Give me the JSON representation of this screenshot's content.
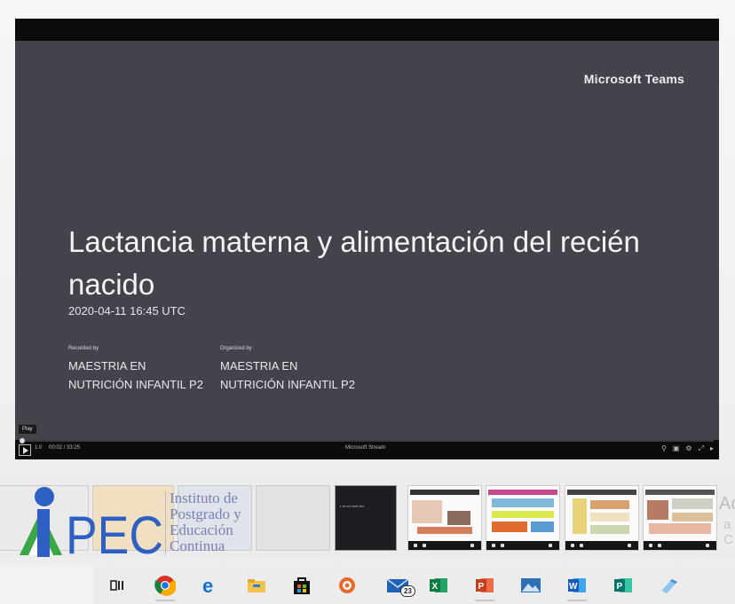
{
  "video": {
    "brand": "Microsoft Teams",
    "title": "Lactancia materna y alimentación del recién nacido",
    "datetime": "2020-04-11 16:45 UTC",
    "recorded_by_label": "Recorded by",
    "recorded_by_name": "MAESTRIA EN NUTRICIÓN INFANTIL P2",
    "organized_by_label": "Organized by",
    "organized_by_name": "MAESTRIA EN NUTRICIÓN INFANTIL P2",
    "play_tooltip": "Play",
    "speed_label": "1.0",
    "time_display": "00:02 / 33:25",
    "player_brand": "Microsoft Stream",
    "progress_fraction": 0.001
  },
  "logo": {
    "acronym": "IPEC",
    "line1": "Instituto de",
    "line2": "Postgrado y",
    "line3": "Educación",
    "line4": "Continua"
  },
  "watermark": {
    "line1": "Activ",
    "line2": "a C"
  },
  "taskbar": {
    "items": [
      {
        "name": "task-view-icon"
      },
      {
        "name": "chrome-icon"
      },
      {
        "name": "edge-icon"
      },
      {
        "name": "file-explorer-icon"
      },
      {
        "name": "store-icon"
      },
      {
        "name": "media-player-icon"
      },
      {
        "name": "mail-icon",
        "badge": "23"
      },
      {
        "name": "excel-icon"
      },
      {
        "name": "powerpoint-icon"
      },
      {
        "name": "photos-icon"
      },
      {
        "name": "word-icon"
      },
      {
        "name": "publisher-icon"
      },
      {
        "name": "paint-icon"
      }
    ]
  },
  "colors": {
    "slide_bg": "#44434c",
    "logo_blue": "#2e5fc2",
    "logo_green": "#3aa646",
    "logo_text": "#7d7fb4"
  }
}
